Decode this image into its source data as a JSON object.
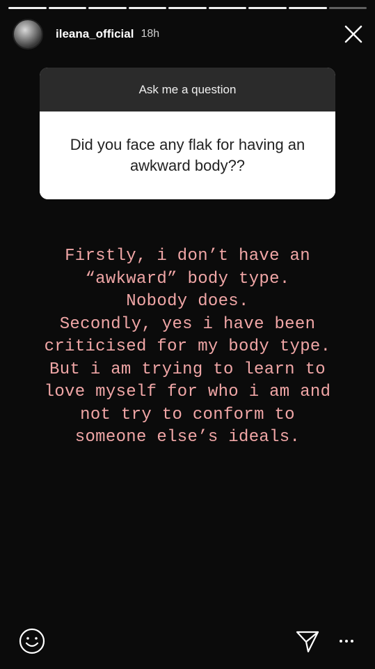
{
  "story": {
    "segments_total": 9,
    "segments_done": 8,
    "username": "ileana_official",
    "time_ago": "18h"
  },
  "question_card": {
    "title": "Ask me a question",
    "question": "Did you face any flak for having an awkward body??"
  },
  "answer_lines": [
    "Firstly, i don’t have an",
    "“awkward” body type.",
    "Nobody does.",
    "Secondly, yes i have been",
    "criticised for my body type.",
    "But i am trying to learn to",
    "love myself for who i am and",
    "not try to conform to",
    "someone else’s ideals."
  ],
  "icons": {
    "close": "close-icon",
    "emoji": "smiley-icon",
    "send": "send-icon",
    "more": "more-icon"
  },
  "colors": {
    "answer_text": "#f0a6a6",
    "card_header": "#2b2b2b",
    "background": "#0b0b0b"
  }
}
